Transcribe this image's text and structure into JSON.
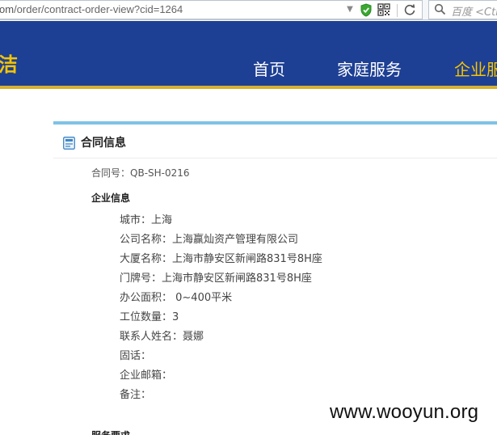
{
  "browser": {
    "url_host_fragment": "om",
    "url_path": "/order/contract-order-view?cid=1264",
    "search_placeholder": "百度 <Ctrl",
    "icons": [
      "chevron-down-icon",
      "shield-icon",
      "qr-code-icon",
      "refresh-icon",
      "search-icon"
    ]
  },
  "site": {
    "logo_char": "洁",
    "nav": [
      {
        "label": "首页",
        "active": false
      },
      {
        "label": "家庭服务",
        "active": false
      },
      {
        "label": "企业服",
        "active": true
      }
    ],
    "colors": {
      "header": "#1d3f94",
      "accent": "#f5c400",
      "card_top": "#7ec2e6"
    }
  },
  "contract": {
    "title": "合同信息",
    "number_label": "合同号：",
    "number": "QB-SH-0216",
    "section_title": "企业信息",
    "fields": [
      {
        "label": "城市：",
        "value": "上海"
      },
      {
        "label": "公司名称：",
        "value": "上海赢灿资产管理有限公司"
      },
      {
        "label": "大厦名称：",
        "value": "上海市静安区新闸路831号8H座"
      },
      {
        "label": "门牌号：",
        "value": "上海市静安区新闸路831号8H座"
      },
      {
        "label": "办公面积：",
        "value": " 0~400平米"
      },
      {
        "label": "工位数量：",
        "value": "3"
      },
      {
        "label": "联系人姓名：",
        "value": "聂娜"
      },
      {
        "label": "固话：",
        "value": ""
      },
      {
        "label": "企业邮箱：",
        "value": ""
      },
      {
        "label": "备注：",
        "value": ""
      }
    ],
    "next_section_title": "服务要求"
  },
  "watermark": "www.wooyun.org"
}
